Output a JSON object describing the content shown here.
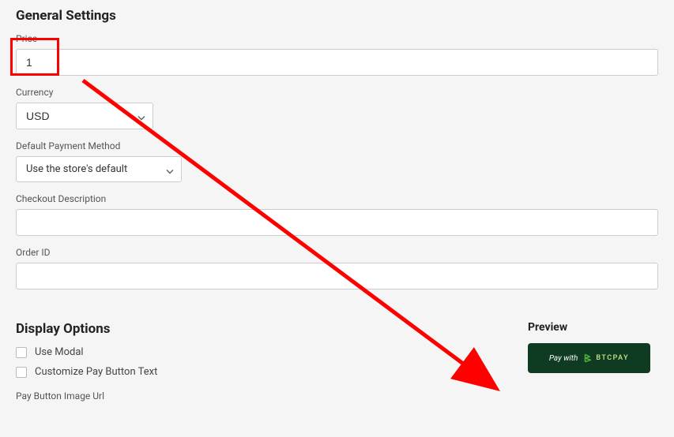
{
  "general": {
    "heading": "General Settings",
    "price_label": "Price",
    "price_value": "1",
    "currency_label": "Currency",
    "currency_value": "USD",
    "payment_method_label": "Default Payment Method",
    "payment_method_value": "Use the store's default",
    "checkout_desc_label": "Checkout Description",
    "checkout_desc_value": "",
    "order_id_label": "Order ID",
    "order_id_value": ""
  },
  "display": {
    "heading": "Display Options",
    "use_modal_label": "Use Modal",
    "customize_text_label": "Customize Pay Button Text",
    "button_image_url_label": "Pay Button Image Url"
  },
  "preview": {
    "heading": "Preview",
    "pay_with": "Pay with",
    "logo_text": "BTCPAY"
  }
}
